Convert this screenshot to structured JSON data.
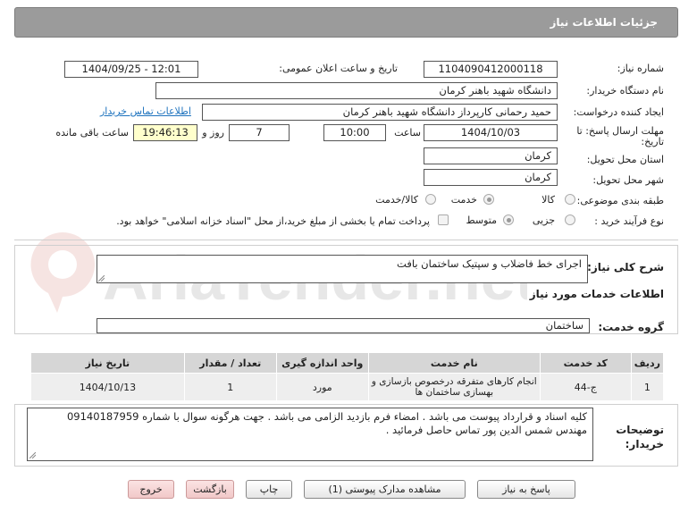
{
  "header": {
    "title": "جزئیات اطلاعات نیاز"
  },
  "fields": {
    "need_number_label": "شماره نیاز:",
    "need_number": "1104090412000118",
    "announce_label": "تاریخ و ساعت اعلان عمومی:",
    "announce_value": "1404/09/25 - 12:01",
    "buyer_org_label": "نام دستگاه خریدار:",
    "buyer_org": "دانشگاه شهید باهنر کرمان",
    "requester_label": "ایجاد کننده درخواست:",
    "requester": "حمید  رحمانی کارپرداز دانشگاه شهید باهنر کرمان",
    "contact_link": "اطلاعات تماس خریدار",
    "deadline_label_1": "مهلت ارسال پاسخ: تا",
    "deadline_label_2": "تاریخ:",
    "deadline_date": "1404/10/03",
    "time_label": "ساعت",
    "deadline_time": "10:00",
    "days": "7",
    "days_label": "روز و",
    "remaining": "19:46:13",
    "remaining_label": "ساعت باقی مانده",
    "province_label": "استان محل تحویل:",
    "province": "کرمان",
    "city_label": "شهر محل تحویل:",
    "city": "کرمان",
    "category_label": "طبقه بندی موضوعی:",
    "category_options": [
      "کالا",
      "خدمت",
      "کالا/خدمت"
    ],
    "process_label": "نوع فرآیند خرید :",
    "process_options": [
      "جزیی",
      "متوسط"
    ],
    "treasury_note": "پرداخت تمام یا بخشی از مبلغ خرید،از محل \"اسناد خزانه اسلامی\" خواهد بود."
  },
  "summary": {
    "label": "شرح کلی نیاز:",
    "value": "اجرای خط فاضلاب و سپتیک ساختمان بافت"
  },
  "services": {
    "section_title": "اطلاعات خدمات مورد نیاز",
    "group_label": "گروه خدمت:",
    "group_value": "ساختمان",
    "columns": [
      "ردیف",
      "کد خدمت",
      "نام خدمت",
      "واحد اندازه گیری",
      "تعداد / مقدار",
      "تاریخ نیاز"
    ],
    "rows": [
      {
        "row": "1",
        "code": "ج-44",
        "name": "انجام کارهای متفرقه درخصوص بازسازی و بهسازی ساختمان ها",
        "unit": "مورد",
        "qty": "1",
        "date": "1404/10/13"
      }
    ]
  },
  "notes": {
    "label_1": "توضیحات",
    "label_2": "خریدار:",
    "line1": "کلیه اسناد و قرارداد پیوست می باشد . امضاء فرم بازدید الزامی می باشد .  جهت هرگونه سوال با شماره 09140187959",
    "line2": "مهندس شمس الدین پور تماس حاصل فرمائید ."
  },
  "buttons": {
    "reply": "پاسخ به نیاز",
    "attachments": "مشاهده مدارک پیوستی (1)",
    "print": "چاپ",
    "back": "بازگشت",
    "exit": "خروج"
  },
  "watermark": {
    "text": "AriaTender.net"
  },
  "colors": {
    "header_bg": "#9b9b9b",
    "remaining_bg": "#ffffcc",
    "link": "#1e73be",
    "exit_btn": "#f1c8c8"
  }
}
